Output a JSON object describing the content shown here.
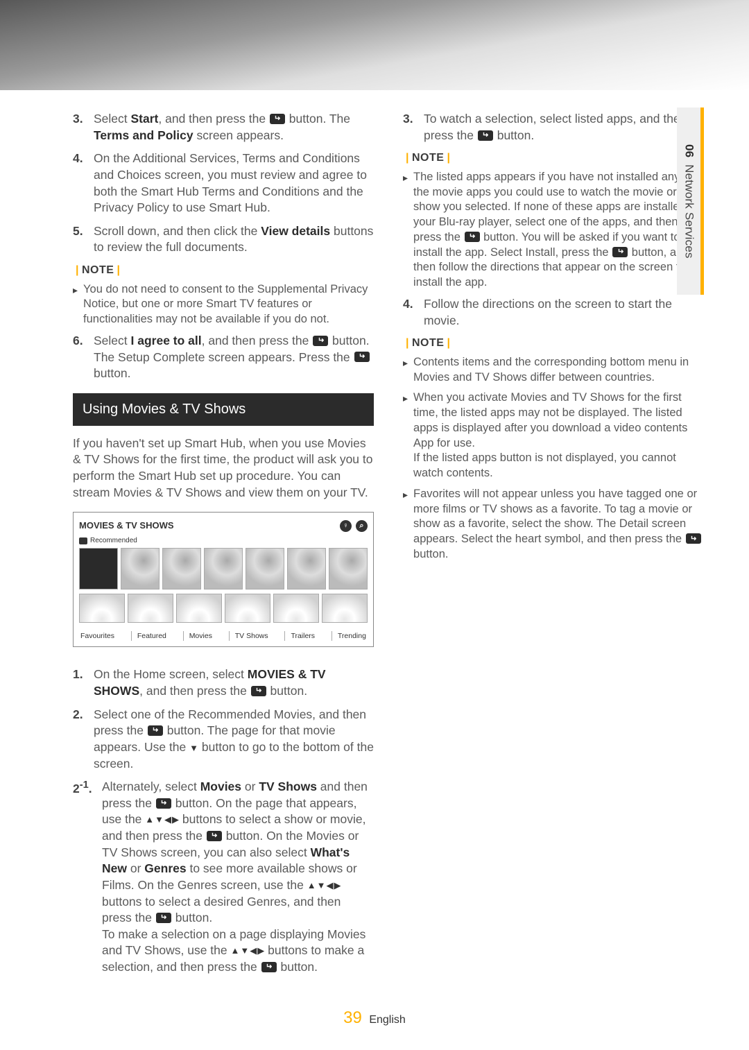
{
  "sideTab": {
    "num": "06",
    "title": "Network Services"
  },
  "left": {
    "items": [
      {
        "num": "3.",
        "body": "Select <b>Start</b>, and then press the [E] button. The <b>Terms and Policy</b> screen appears."
      },
      {
        "num": "4.",
        "body": "On the Additional Services, Terms and Conditions and Choices screen, you must review and agree to both the Smart Hub Terms and Conditions and the Privacy Policy to use Smart Hub."
      },
      {
        "num": "5.",
        "body": "Scroll down, and then click the <b>View details</b> buttons to review the full documents."
      }
    ],
    "note1Label": "NOTE",
    "note1": "You do not need to consent to the Supplemental Privacy Notice, but one or more Smart TV features or functionalities may not be available if you do not.",
    "item6": {
      "num": "6.",
      "body": "Select <b>I agree to all</b>, and then press the [E] button. The Setup Complete screen appears. Press the [E] button."
    },
    "heading": "Using Movies & TV Shows",
    "intro": "If you haven't set up Smart Hub, when you use Movies & TV Shows for the first time, the product will ask you to perform the Smart Hub set up procedure. You can stream Movies & TV Shows and view them on your TV.",
    "shot": {
      "title": "MOVIES & TV SHOWS",
      "reco": "Recommended",
      "tabs": [
        "Favourites",
        "Featured",
        "Movies",
        "TV Shows",
        "Trailers",
        "Trending"
      ]
    },
    "items2": [
      {
        "num": "1.",
        "body": "On the Home screen, select <b>MOVIES & TV SHOWS</b>, and then press the [E] button."
      },
      {
        "num": "2.",
        "body": "Select one of the Recommended Movies, and then press the [E] button. The page for that movie appears. Use the [V] button to go to the bottom of the screen."
      }
    ]
  },
  "right": {
    "items": [
      {
        "num": "2⁻¹.",
        "body": "Alternately, select <b>Movies</b> or <b>TV Shows</b> and then press the [E] button. On the page that appears, use the [A] buttons to select a show or movie, and then press the [E] button. On the Movies or TV Shows screen, you can also select <b>What's New</b> or <b>Genres</b> to see more available shows or Films. On the Genres screen, use the [A] buttons to select a desired Genres, and then press the [E] button.<br>To make a selection on a page displaying Movies and TV Shows, use the [A] buttons to make a selection, and then press the [E] button."
      },
      {
        "num": "3.",
        "body": "To watch a selection, select listed apps, and then press the [E] button."
      }
    ],
    "note1Label": "NOTE",
    "note1": "The listed apps appears if you have not installed any of the movie apps you could use to watch the movie or TV show you selected. If none of these apps are installed on your Blu-ray player, select one of the apps, and then press the [E] button. You will be asked if you want to install the app. Select Install, press the [E] button, and then follow the directions that appear on the screen to install the app.",
    "item4": {
      "num": "4.",
      "body": "Follow the directions on the screen to start the movie."
    },
    "note2Label": "NOTE",
    "note2": [
      "Contents items and the corresponding bottom menu in Movies and TV Shows differ between countries.",
      "When you activate Movies and TV Shows for the first time, the listed apps may not be displayed. The listed apps is displayed after you download a video contents App for use.<br>If the listed apps button is not displayed, you cannot watch contents.",
      "Favorites will not appear unless you have tagged one or more  films or TV shows as a favorite. To tag a movie or show as a favorite, select the show. The Detail screen appears. Select the heart symbol, and then press the [E] button."
    ]
  },
  "footer": {
    "page": "39",
    "lang": "English"
  }
}
